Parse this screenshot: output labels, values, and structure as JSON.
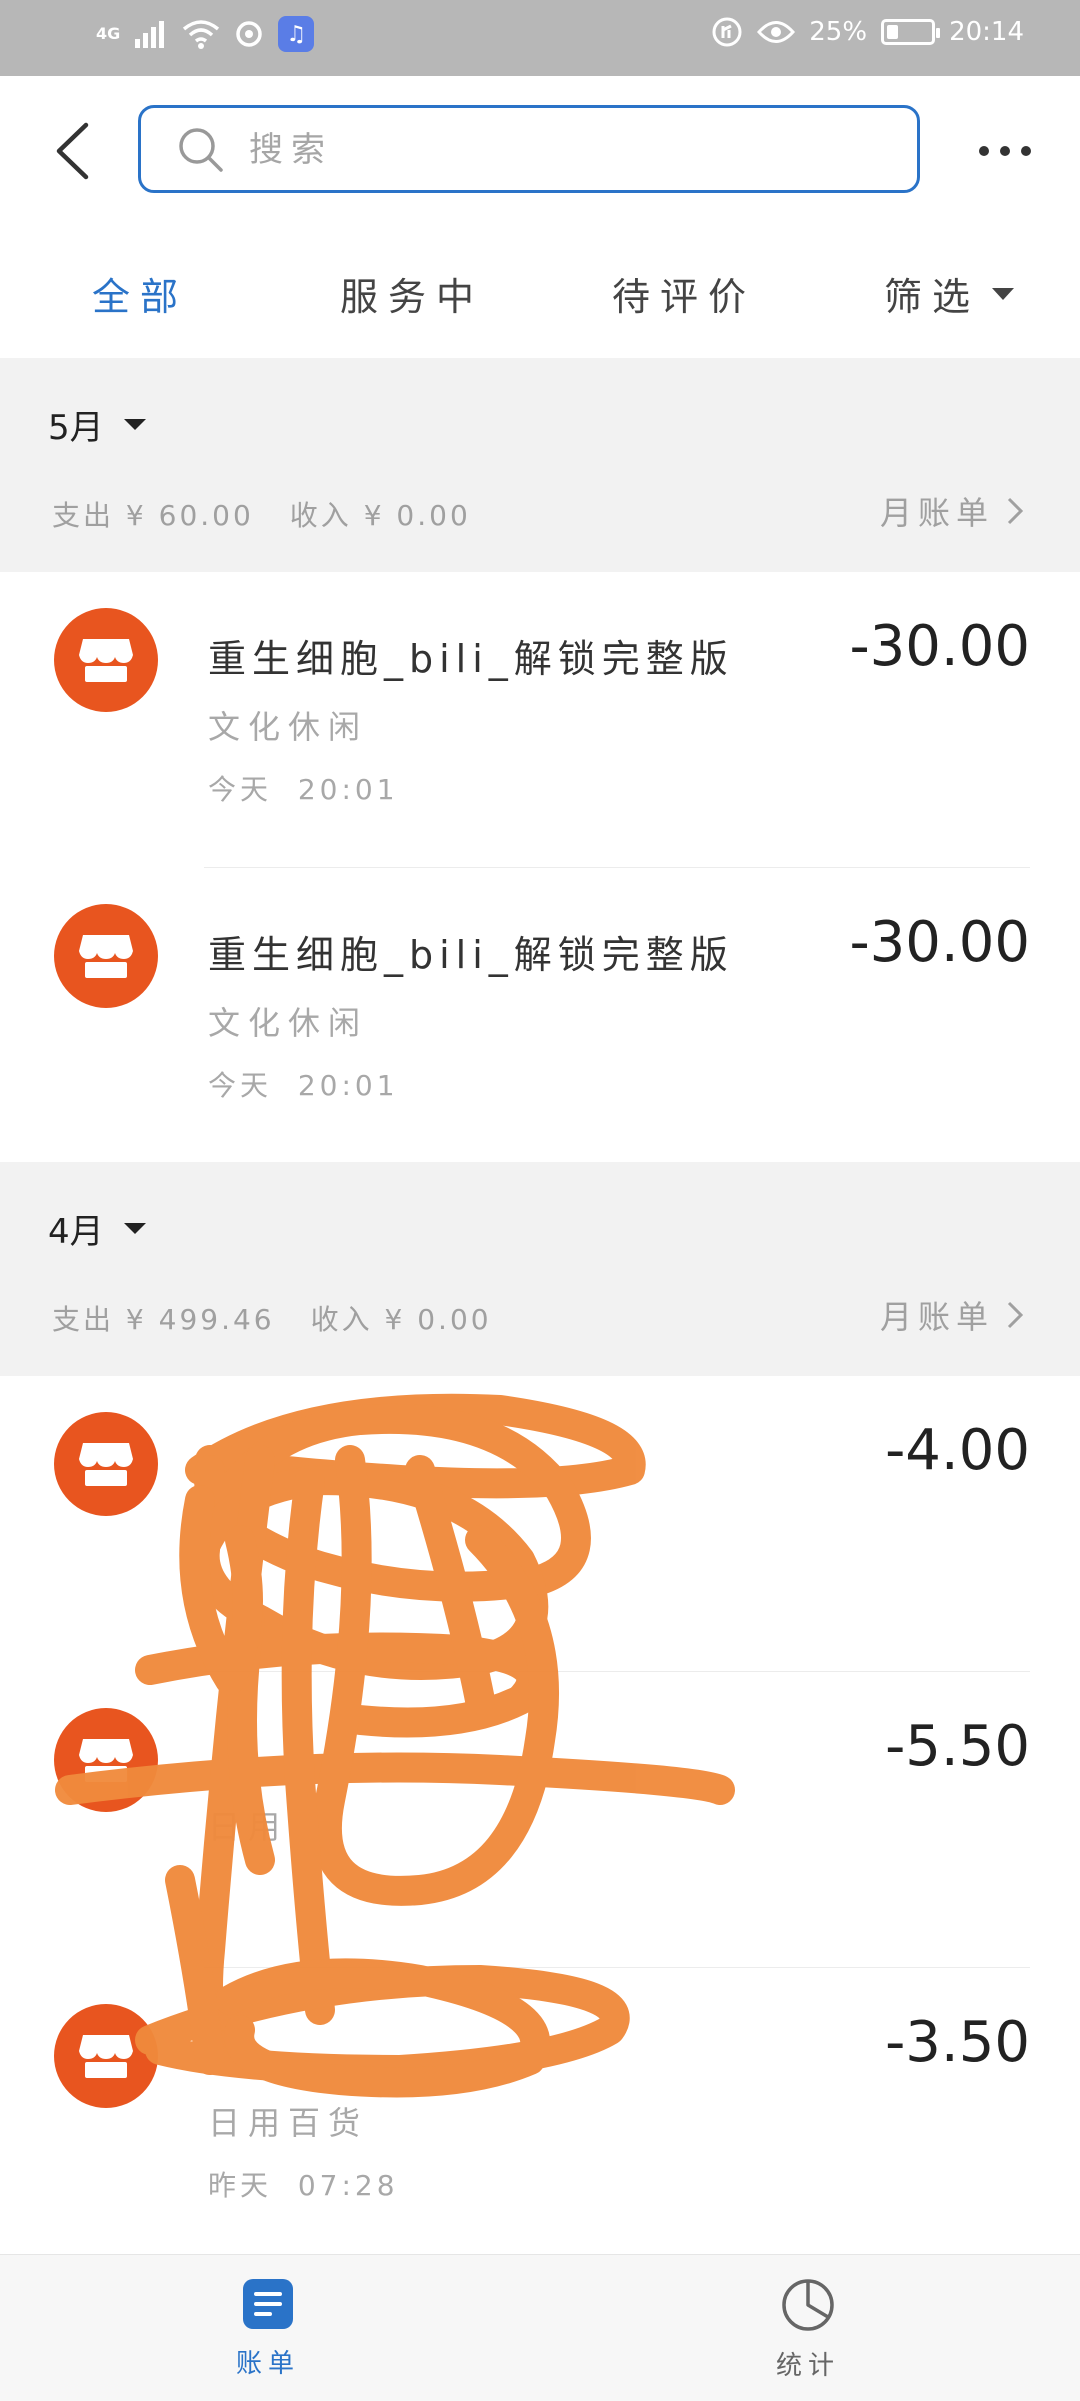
{
  "status_bar": {
    "network": "4G",
    "app_icon": "music-note-icon",
    "battery_percent": "25%",
    "battery_level": 0.25,
    "time": "20:14"
  },
  "header": {
    "search_placeholder": "搜索"
  },
  "tabs": [
    {
      "label": "全部",
      "active": true
    },
    {
      "label": "服务中",
      "active": false
    },
    {
      "label": "待评价",
      "active": false
    },
    {
      "label": "筛选",
      "active": false
    }
  ],
  "sections": [
    {
      "month": "5月",
      "expense_label": "支出",
      "expense_value": "¥ 60.00",
      "income_label": "收入",
      "income_value": "¥ 0.00",
      "bill_link": "月账单",
      "items": [
        {
          "title": "重生细胞_bili_解锁完整版",
          "category": "文化休闲",
          "day": "今天",
          "time": "20:01",
          "amount": "-30.00"
        },
        {
          "title": "重生细胞_bili_解锁完整版",
          "category": "文化休闲",
          "day": "今天",
          "time": "20:01",
          "amount": "-30.00"
        }
      ]
    },
    {
      "month": "4月",
      "expense_label": "支出",
      "expense_value": "¥ 499.46",
      "income_label": "收入",
      "income_value": "¥ 0.00",
      "bill_link": "月账单",
      "items": [
        {
          "title": "",
          "category": "",
          "day": "",
          "time": "",
          "amount": "-4.00"
        },
        {
          "title": "",
          "category": "日用",
          "day": "",
          "time": "",
          "amount": "-5.50"
        },
        {
          "title": "",
          "category": "日用百货",
          "day": "昨天",
          "time": "07:28",
          "amount": "-3.50"
        }
      ]
    }
  ],
  "bottom_nav": [
    {
      "label": "账单",
      "icon": "bill-list-icon",
      "active": true
    },
    {
      "label": "统计",
      "icon": "pie-chart-icon",
      "active": false
    }
  ],
  "colors": {
    "accent": "#2a73c8",
    "merchant_icon": "#e8551f",
    "scribble": "#f08a3c"
  }
}
